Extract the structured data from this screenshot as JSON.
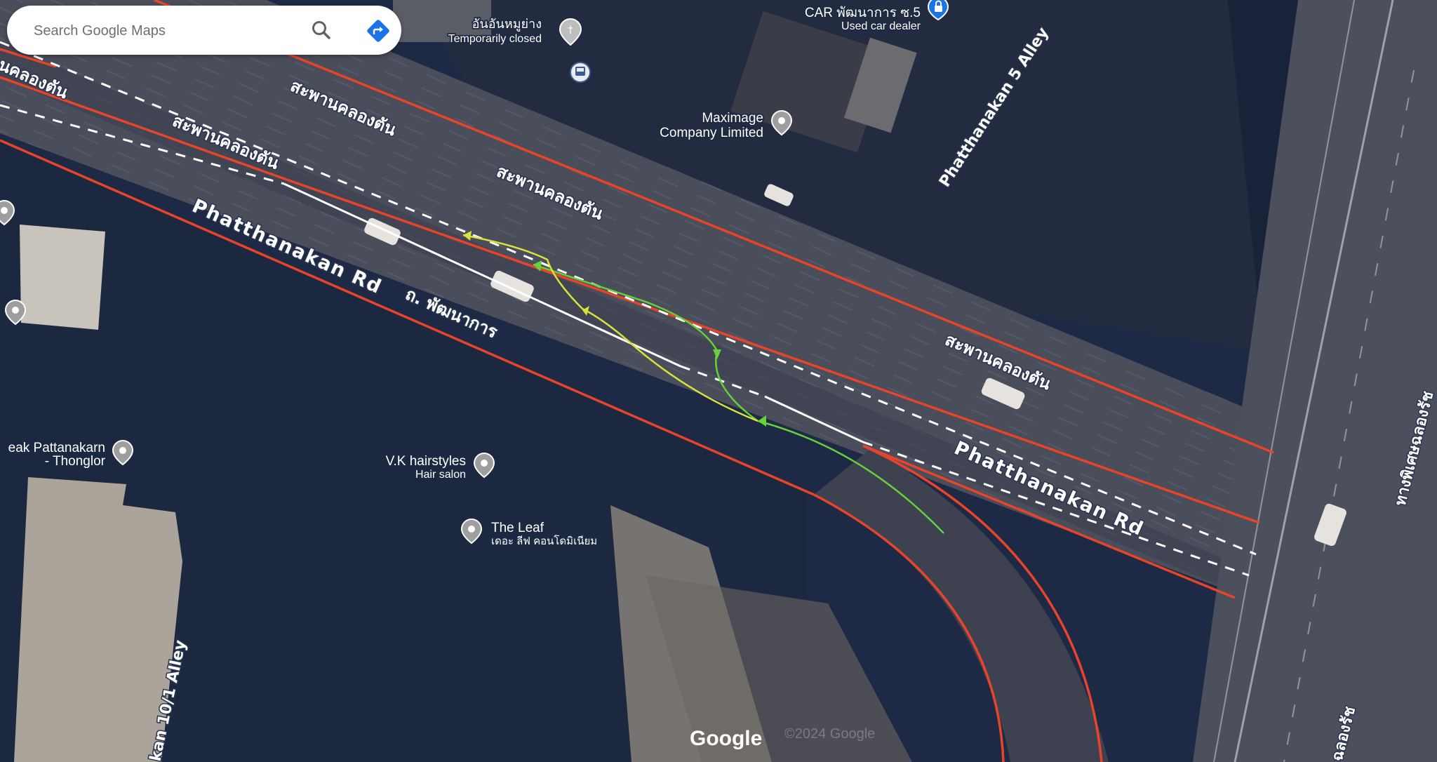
{
  "search": {
    "placeholder": "Search Google Maps"
  },
  "pois": {
    "restaurant_name": "อันอันหมูย่าง",
    "restaurant_status": "Temporarily closed",
    "car_dealer_name": "CAR พัฒนาการ ซ.5",
    "car_dealer_type": "Used car dealer",
    "maximage_line1": "Maximage",
    "maximage_line2": "Company Limited",
    "peak_line1": "eak Pattanakarn",
    "peak_line2": "- Thonglor",
    "vk_name": "V.K hairstyles",
    "vk_type": "Hair salon",
    "leaf_name": "The Leaf",
    "leaf_subtitle": "เดอะ ลีฟ คอนโดมิเนียม"
  },
  "roads": {
    "bridge_1": "สะพานคลองตัน",
    "bridge_2": "สะพานคลองตัน",
    "bridge_3": "สะพานคลองตัน",
    "bridge_4": "สะพานคลองตัน",
    "bridge_left": "นคลองตัน",
    "phatthanakan_1": "Phatthanakan Rd",
    "phatthanakan_2": "Phatthanakan Rd",
    "phatthanakan_thai": "ถ. พัฒนาการ",
    "alley_5": "Phatthanakan 5 Alley",
    "alley_10": "kan 10/1 Alley",
    "expressway_1": "ทางพิเศษฉลองรัช",
    "expressway_2": "ฉลองรัช"
  },
  "attribution": {
    "logo": "Google",
    "copyright": "©2024 Google"
  },
  "colors": {
    "red_line": "#e8442a",
    "green_arrow": "#66d13a",
    "yellow_arrow": "#d8e23a",
    "accent_blue": "#1a73e8"
  }
}
